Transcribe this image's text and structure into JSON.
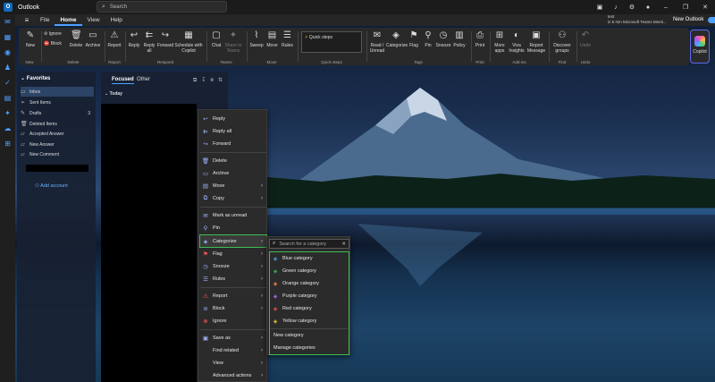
{
  "app": {
    "title": "Outlook",
    "logo": "O",
    "search_placeholder": "Search"
  },
  "titlebar_icons": [
    "meeting-icon",
    "bell-icon",
    "gear-icon",
    "avatar"
  ],
  "ribbon_tabs": [
    "File",
    "Home",
    "View",
    "Help"
  ],
  "active_tab": "Home",
  "notification": {
    "line1": "test",
    "line2": "in 5 min Microsoft Teams Meeti..."
  },
  "new_outlook_label": "New Outlook",
  "ribbon": {
    "new_label": "New",
    "ignore_label": "Ignore",
    "block_label": "Block",
    "delete_label": "Delete",
    "archive_label": "Archive",
    "report_label": "Report",
    "reply_label": "Reply",
    "reply_all_label": "Reply all",
    "forward_label": "Forward",
    "schedule_label": "Schedule with Copilot",
    "chat_label": "Chat",
    "share_teams_label": "Share to Teams",
    "sweep_label": "Sweep",
    "move_label": "Move",
    "rules_label": "Rules",
    "quick_steps_label": "Quick steps",
    "read_unread_label": "Read / Unread",
    "categorize_label": "Categorize",
    "flag_label": "Flag",
    "pin_label": "Pin",
    "snooze_label": "Snooze",
    "policy_label": "Policy",
    "print_label": "Print",
    "more_apps_label": "More apps",
    "viva_label": "Viva Insights",
    "report_message_label": "Report Message",
    "discover_groups_label": "Discover groups",
    "undo_label": "Undo",
    "copilot_label": "Copilot",
    "groups": {
      "new": "New",
      "delete": "Delete",
      "report": "Report",
      "respond": "Respond",
      "teams": "Teams",
      "move": "Move",
      "quick_steps": "Quick steps",
      "tags": "Tags",
      "print": "Print",
      "addins": "Add-ins",
      "find": "Find",
      "undo": "Undo"
    }
  },
  "folders": {
    "header": "Favorites",
    "items": [
      {
        "label": "Inbox",
        "count": ""
      },
      {
        "label": "Sent Items",
        "count": ""
      },
      {
        "label": "Drafts",
        "count": "3"
      },
      {
        "label": "Deleted Items",
        "count": ""
      },
      {
        "label": "Accepted Answer",
        "count": ""
      },
      {
        "label": "New Answer",
        "count": ""
      },
      {
        "label": "New Comment",
        "count": ""
      }
    ],
    "add_account": "Add account"
  },
  "msglist": {
    "tab_focused": "Focused",
    "tab_other": "Other",
    "group_today": "Today"
  },
  "context_menu": {
    "reply": "Reply",
    "reply_all": "Reply all",
    "forward": "Forward",
    "delete": "Delete",
    "archive": "Archive",
    "move": "Move",
    "copy": "Copy",
    "mark_unread": "Mark as unread",
    "pin": "Pin",
    "categorize": "Categorize",
    "flag": "Flag",
    "snooze": "Snooze",
    "rules": "Rules",
    "report": "Report",
    "block": "Block",
    "ignore": "Ignore",
    "save_as": "Save as",
    "find_related": "Find related",
    "view": "View",
    "advanced": "Advanced actions"
  },
  "categorize_submenu": {
    "search_placeholder": "Search for a category",
    "categories": [
      {
        "label": "Blue category",
        "color": "#4ea1ff"
      },
      {
        "label": "Green category",
        "color": "#3dbd52"
      },
      {
        "label": "Orange category",
        "color": "#ff8a3d"
      },
      {
        "label": "Purple category",
        "color": "#b36bff"
      },
      {
        "label": "Red category",
        "color": "#ff4d4d"
      },
      {
        "label": "Yellow category",
        "color": "#f2c230"
      }
    ],
    "new_category": "New category",
    "manage_categories": "Manage categories"
  }
}
